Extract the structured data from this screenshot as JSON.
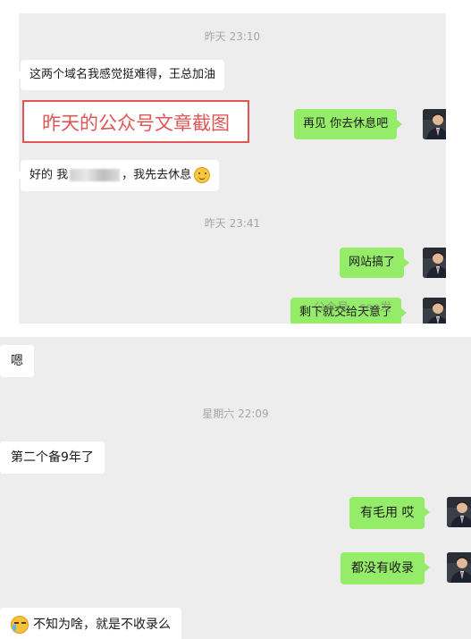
{
  "top_panel": {
    "time_1": "昨天 23:10",
    "msg_1": "这两个域名我感觉挺难得，王总加油",
    "banner": "昨天的公众号文章截图",
    "msg_2": "再见  你去休息吧",
    "msg_3_prefix": "好的 我",
    "msg_3_suffix": "，我先去休息",
    "time_2": "昨天 23:41",
    "msg_4": "网站搞了",
    "msg_5": "剩下就交给天意了",
    "watermark": "公众号 · seo发"
  },
  "bottom_panel": {
    "msg_1": "嗯",
    "time_1": "星期六 22:09",
    "msg_2": "第二个备9年了",
    "msg_3": "有毛用 哎",
    "msg_4": "都没有收录",
    "msg_5": "不知为啥，就是不收录么"
  },
  "colors": {
    "chat_bg": "#ededed",
    "sent_bubble": "#95ec69",
    "received_bubble": "#ffffff",
    "banner_red": "#e05555"
  },
  "icons": {
    "avatar": "man-in-suit-avatar",
    "smile": "smile-emoji",
    "cry": "crying-emoji"
  }
}
